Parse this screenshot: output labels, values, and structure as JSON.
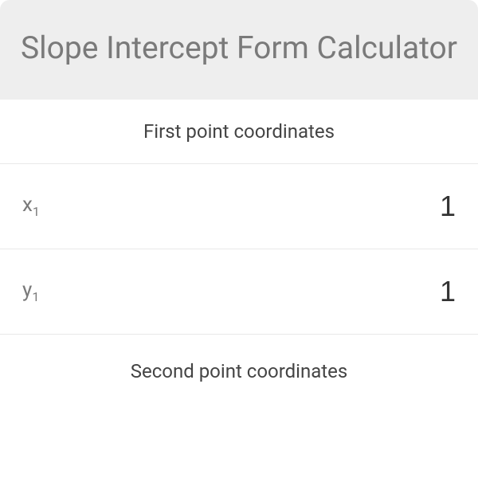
{
  "header": {
    "title": "Slope Intercept Form Calculator"
  },
  "sections": {
    "first": {
      "heading": "First point coordinates",
      "x_label": "x",
      "x_sub": "1",
      "x_value": "1",
      "y_label": "y",
      "y_sub": "1",
      "y_value": "1"
    },
    "second": {
      "heading": "Second point coordinates"
    }
  }
}
